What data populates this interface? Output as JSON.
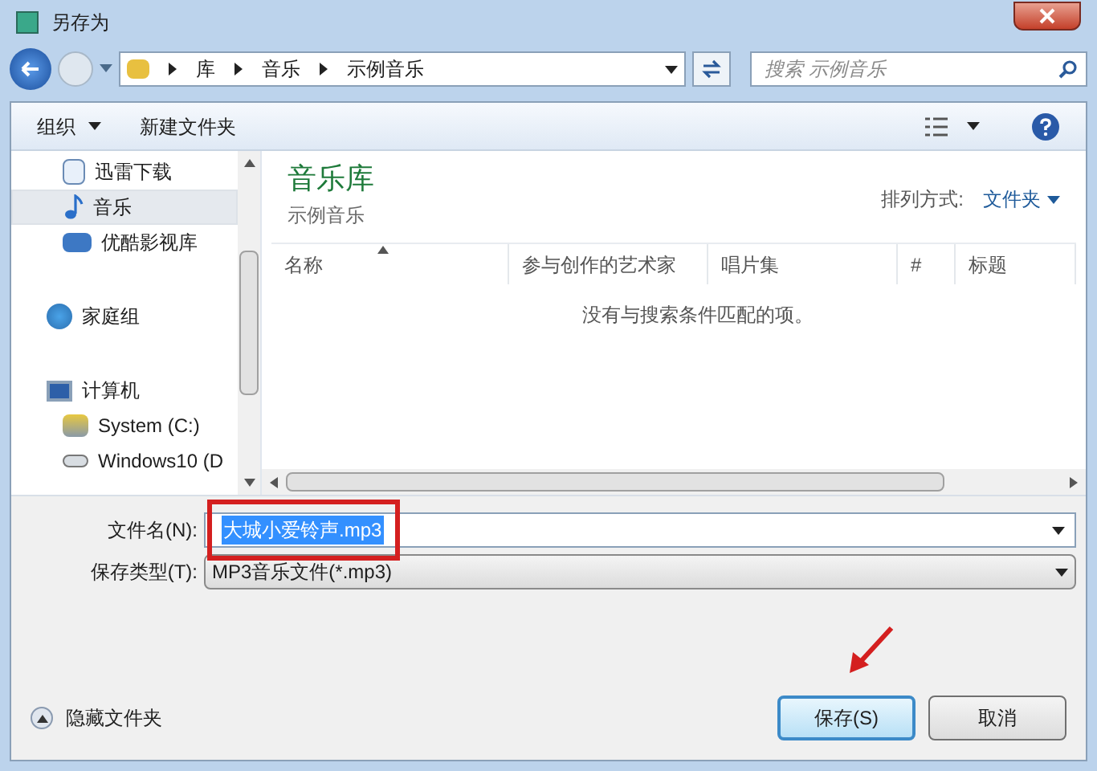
{
  "window": {
    "title": "另存为"
  },
  "breadcrumb": [
    "库",
    "音乐",
    "示例音乐"
  ],
  "search": {
    "placeholder": "搜索 示例音乐"
  },
  "toolbar": {
    "organize": "组织",
    "new_folder": "新建文件夹"
  },
  "sidebar": {
    "items": [
      {
        "label": "迅雷下载",
        "group": false,
        "selected": false
      },
      {
        "label": "音乐",
        "group": false,
        "selected": true
      },
      {
        "label": "优酷影视库",
        "group": false,
        "selected": false
      },
      {
        "label": "家庭组",
        "group": true,
        "selected": false
      },
      {
        "label": "计算机",
        "group": true,
        "selected": false
      },
      {
        "label": "System (C:)",
        "group": false,
        "selected": false
      },
      {
        "label": "Windows10 (D",
        "group": false,
        "selected": false
      }
    ]
  },
  "library": {
    "title": "音乐库",
    "subtitle": "示例音乐",
    "arrange_label": "排列方式:",
    "arrange_value": "文件夹"
  },
  "table": {
    "columns": [
      "名称",
      "参与创作的艺术家",
      "唱片集",
      "#",
      "标题"
    ],
    "empty_message": "没有与搜索条件匹配的项。"
  },
  "form": {
    "filename_label": "文件名(N):",
    "filename_value": "大城小爱铃声.mp3",
    "filetype_label": "保存类型(T):",
    "filetype_value": "MP3音乐文件(*.mp3)"
  },
  "footer": {
    "hide_folders": "隐藏文件夹",
    "buttons": [
      {
        "label": "保存(S)",
        "default": true
      },
      {
        "label": "取消",
        "default": false
      }
    ]
  }
}
